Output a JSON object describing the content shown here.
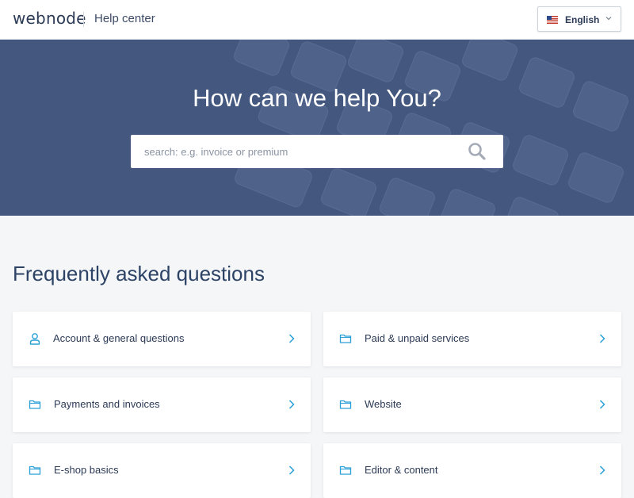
{
  "header": {
    "logo": "webnode",
    "title": "Help center",
    "language": {
      "selected": "English",
      "flag_icon": "us-flag-icon"
    }
  },
  "hero": {
    "heading": "How can we help You?",
    "search": {
      "placeholder": "search: e.g. invoice or premium",
      "value": "",
      "icon": "search-icon"
    }
  },
  "faq": {
    "heading": "Frequently asked questions",
    "categories": [
      {
        "label": "Account & general questions",
        "icon": "user-icon"
      },
      {
        "label": "Paid & unpaid services",
        "icon": "folder-icon"
      },
      {
        "label": "Payments and invoices",
        "icon": "folder-icon"
      },
      {
        "label": "Website",
        "icon": "folder-icon"
      },
      {
        "label": "E-shop basics",
        "icon": "folder-icon"
      },
      {
        "label": "Editor & content",
        "icon": "folder-icon"
      }
    ]
  },
  "colors": {
    "hero_bg": "#43577f",
    "accent": "#2a9fd8",
    "text": "#2b3a55",
    "page_bg": "#f5f6f8"
  }
}
